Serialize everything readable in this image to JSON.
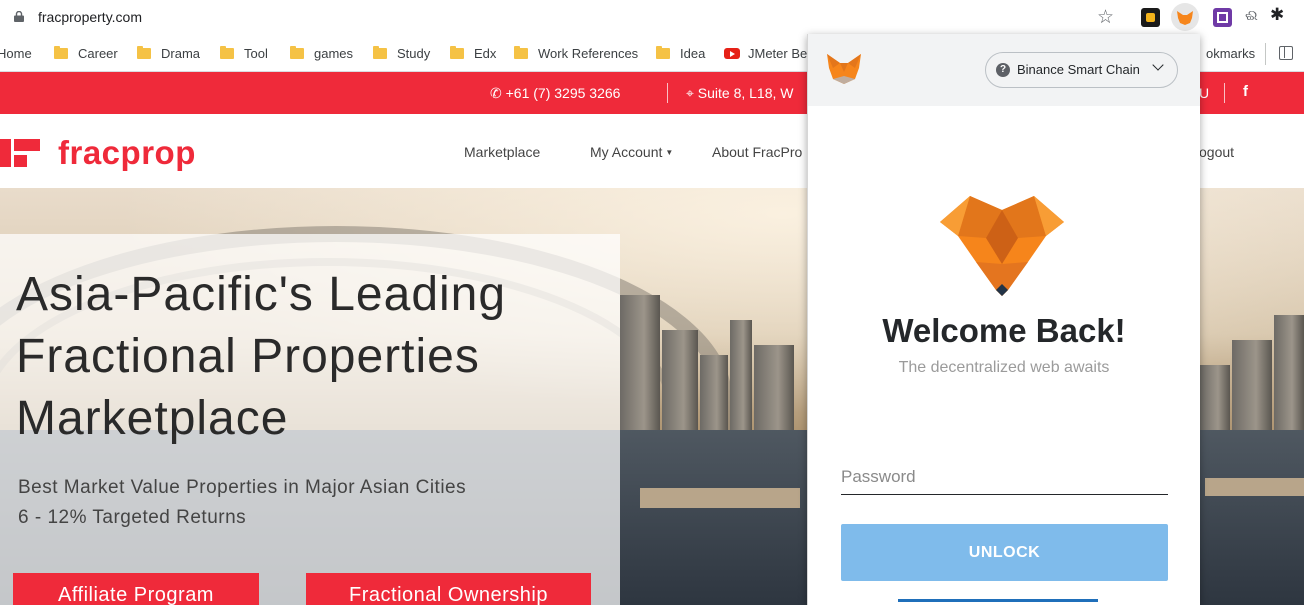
{
  "browser": {
    "url": "fracproperty.com",
    "bookmarks": [
      {
        "label": "Home",
        "icon": "none"
      },
      {
        "label": "Career",
        "icon": "folder-icon"
      },
      {
        "label": "Drama",
        "icon": "folder-icon"
      },
      {
        "label": "Tool",
        "icon": "folder-icon"
      },
      {
        "label": "games",
        "icon": "folder-icon"
      },
      {
        "label": "Study",
        "icon": "folder-icon"
      },
      {
        "label": "Edx",
        "icon": "folder-icon"
      },
      {
        "label": "Work References",
        "icon": "folder-icon"
      },
      {
        "label": "Idea",
        "icon": "folder-icon"
      },
      {
        "label": "JMeter Be",
        "icon": "youtube-icon"
      }
    ],
    "bookmarks_right": "okmarks"
  },
  "site": {
    "topbar": {
      "phone": "+61 (7) 3295 3266",
      "address": "Suite 8, L18, W",
      "right_text": "U",
      "facebook": "f"
    },
    "logo_text": "fracprop",
    "nav": {
      "marketplace": "Marketplace",
      "my_account": "My Account",
      "about": "About FracPro",
      "logout": "ogout"
    },
    "hero": {
      "title_lines": [
        "Asia-Pacific's Leading",
        "Fractional Properties",
        "Marketplace"
      ],
      "subtitle_lines": [
        "Best Market Value Properties in Major Asian Cities",
        "6 - 12% Targeted Returns"
      ],
      "affiliate_button": "Affiliate Program",
      "ownership_button": "Fractional Ownership"
    }
  },
  "metamask": {
    "network": "Binance Smart Chain",
    "welcome": "Welcome Back!",
    "tagline": "The decentralized web awaits",
    "password_placeholder": "Password",
    "password_value": "",
    "unlock_label": "UNLOCK"
  },
  "colors": {
    "brand_red": "#ef2a3a",
    "unlock_blue": "#7fbbeb",
    "metamask_orange": "#f6851b"
  }
}
